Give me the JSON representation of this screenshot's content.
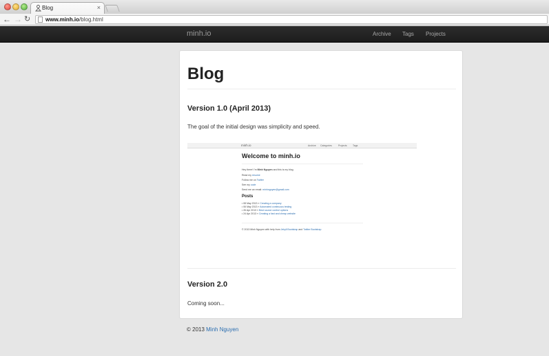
{
  "browser": {
    "tab_title": "Blog",
    "url_domain": "www.minh.io",
    "url_path": "/blog.html",
    "close_glyph": "×"
  },
  "navbar": {
    "brand": "minh.io",
    "links": [
      "Archive",
      "Tags",
      "Projects"
    ]
  },
  "blog": {
    "title": "Blog",
    "posts": [
      {
        "title": "Version 1.0 (April 2013)",
        "text": "The goal of the initial design was simplicity and speed."
      },
      {
        "title": "Version 2.0",
        "text": "Coming soon..."
      }
    ]
  },
  "screenshot": {
    "brand": "minh.io",
    "links": [
      "Archive",
      "Categories",
      "Projects",
      "Tags"
    ],
    "title": "Welcome to minh.io",
    "intro_prefix": "Hey there! I'm ",
    "intro_name": "Minh Nguyen",
    "intro_suffix": " and this is my blog.",
    "read_prefix": "Read my ",
    "read_link": "resume",
    "follow_prefix": "Follow me on ",
    "follow_link": "Twitter",
    "see_prefix": "See my ",
    "see_link": "code",
    "email_prefix": "Send me an email: ",
    "email_link": "minhnguyen@gmail.com",
    "posts_heading": "Posts",
    "posts": [
      {
        "date": "08 May 2013 » ",
        "title": "Creating a company"
      },
      {
        "date": "06 May 2013 » ",
        "title": "Automated continuous testing"
      },
      {
        "date": "26 Apr 2013 » ",
        "title": "Best source control options"
      },
      {
        "date": "24 Apr 2013 » ",
        "title": "Creating a fast and cheap website"
      }
    ],
    "footer_prefix": "© 2013 Minh Nguyen with help from ",
    "footer_link1": "Jekyll Bootstrap",
    "footer_and": " and ",
    "footer_link2": "Twitter Bootstrap"
  },
  "footer": {
    "copyright": "© 2013 ",
    "author": "Minh Nguyen"
  }
}
